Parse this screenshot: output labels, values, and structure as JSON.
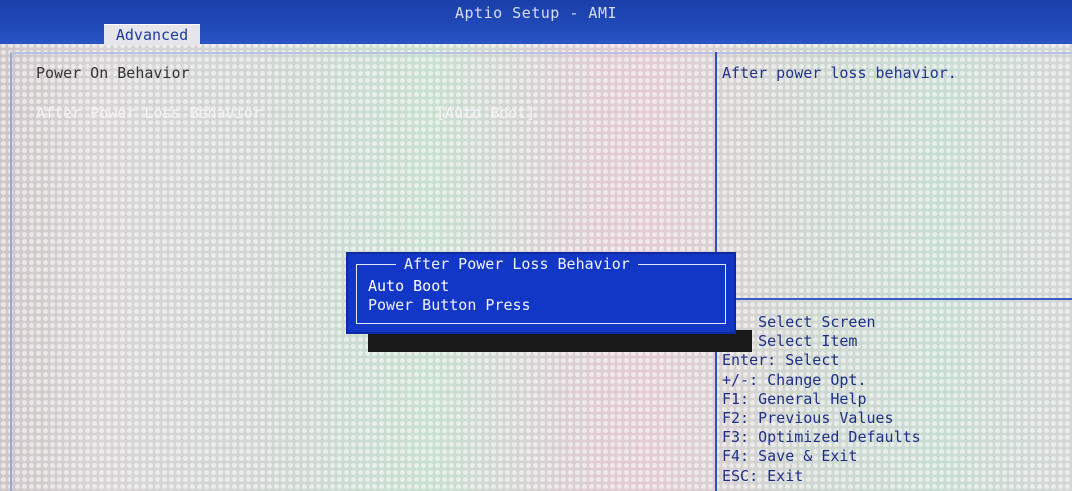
{
  "header": {
    "title": "Aptio Setup - AMI",
    "tab_label": "Advanced"
  },
  "main": {
    "section_title": "Power On Behavior",
    "setting": {
      "label": "After Power Loss Behavior",
      "value": "[Auto Boot]"
    }
  },
  "help": {
    "text": "After power loss behavior."
  },
  "keys": [
    "    Select Screen",
    "    Select Item",
    "Enter: Select",
    "+/-: Change Opt.",
    "F1: General Help",
    "F2: Previous Values",
    "F3: Optimized Defaults",
    "F4: Save & Exit",
    "ESC: Exit"
  ],
  "popup": {
    "title": "After Power Loss Behavior",
    "options": [
      "Auto Boot",
      "Power Button Press"
    ],
    "selected": "Auto Boot"
  },
  "colors": {
    "titlebar": "#2049b8",
    "popup_bg": "#1236c6",
    "accent_text": "#1b3c9c"
  }
}
